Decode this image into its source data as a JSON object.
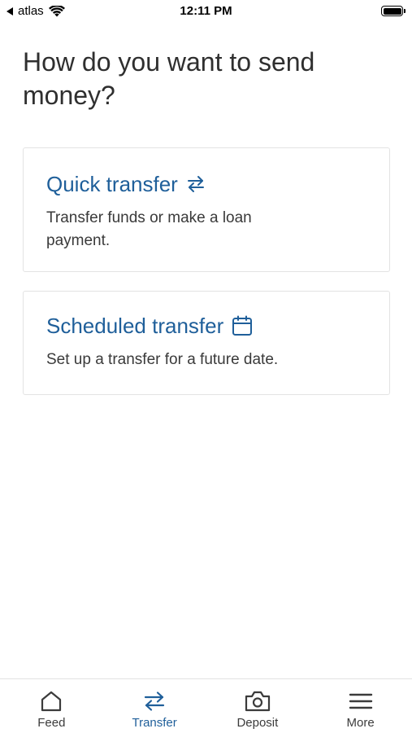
{
  "status_bar": {
    "carrier": "atlas",
    "time": "12:11 PM"
  },
  "page": {
    "title": "How do you want to send money?"
  },
  "options": [
    {
      "title": "Quick transfer",
      "icon": "transfer-arrows-icon",
      "description": "Transfer funds or make a loan payment."
    },
    {
      "title": "Scheduled transfer",
      "icon": "calendar-icon",
      "description": "Set up a transfer for a future date."
    }
  ],
  "tab_bar": {
    "active": "Transfer",
    "items": [
      {
        "label": "Feed",
        "icon": "home-icon"
      },
      {
        "label": "Transfer",
        "icon": "transfer-arrows-icon"
      },
      {
        "label": "Deposit",
        "icon": "camera-icon"
      },
      {
        "label": "More",
        "icon": "menu-icon"
      }
    ]
  },
  "colors": {
    "accent": "#1f5f9a",
    "text": "#2f2f2f",
    "card_border": "#e3e3e3"
  }
}
